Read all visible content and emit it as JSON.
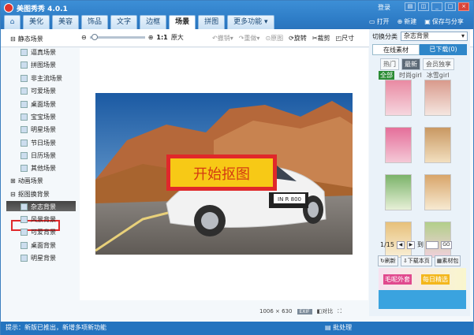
{
  "app": {
    "title": "美图秀秀 4.0.1"
  },
  "titlebar": {
    "login": "登录"
  },
  "tabs": [
    "美化",
    "美容",
    "饰品",
    "文字",
    "边框",
    "场景",
    "拼图",
    "更多功能"
  ],
  "actions": {
    "open": "打开",
    "new": "新建",
    "save": "保存与分享"
  },
  "toolbar": {
    "zoom_label": "1:1",
    "original": "原大",
    "rotate": "旋转",
    "crop": "裁剪",
    "resize": "尺寸",
    "undo": "撤销",
    "redo": "重做",
    "restore": "原图"
  },
  "sidebar": {
    "static": "静态场景",
    "static_items": [
      "逼真场景",
      "拼图场景",
      "非主流场景",
      "可爱场景",
      "桌面场景",
      "宝宝场景",
      "明星场景",
      "节日场景",
      "日历场景",
      "其他场景"
    ],
    "animated": "动画场景",
    "cutout": "抠图换背景",
    "cutout_items": [
      "杂志背景",
      "风景背景",
      "可爱背景",
      "桌面背景",
      "明星背景"
    ]
  },
  "canvas": {
    "overlay_text": "开始抠图",
    "plate": "IN R 800",
    "dims": "1006 × 630",
    "exif": "EXIF",
    "compare": "对比"
  },
  "rightpanel": {
    "switch_label": "切换分类",
    "category": "杂志背景",
    "tab_online": "在线素材",
    "tab_downloaded": "已下载(0)",
    "subtabs": [
      "热门",
      "最新",
      "会员独享"
    ],
    "cats": [
      "全部",
      "时尚girl",
      "冰雪girl"
    ],
    "page": "1/15",
    "goto": "到",
    "go": "GO",
    "refresh": "刷新",
    "download_page": "下载本页",
    "library": "素材包",
    "banner_left": "毛呢外套",
    "banner_right": "每日精选"
  },
  "statusbar": {
    "left": "提示：新版已推出，新增多项新功能",
    "batch": "批处理"
  },
  "colors": {
    "accent": "#2f7ec8",
    "highlight": "#e0282a",
    "overlay": "#f7c916"
  }
}
